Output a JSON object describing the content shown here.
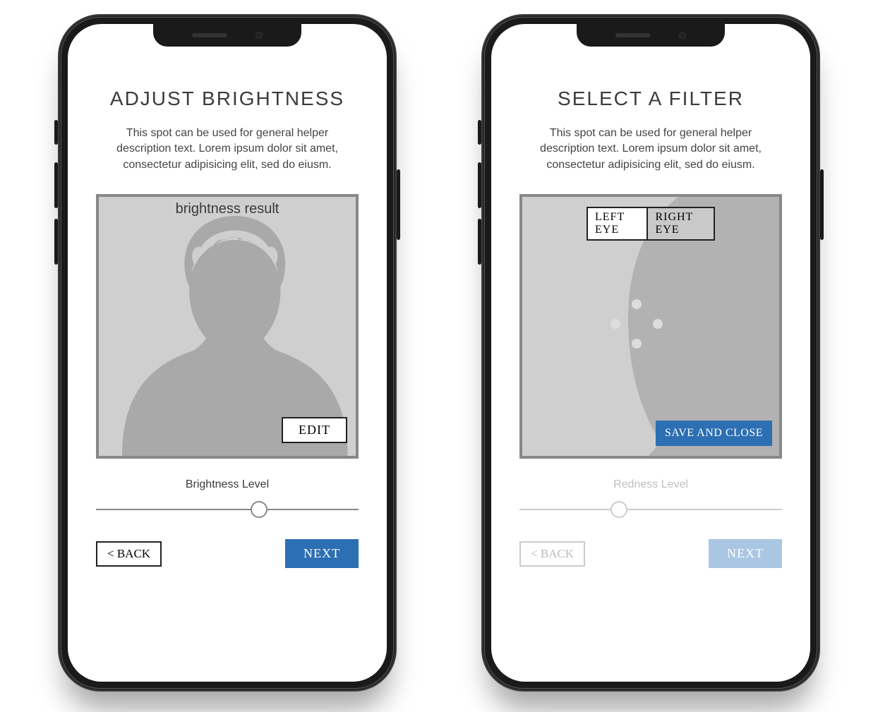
{
  "screens": {
    "brightness": {
      "title": "ADJUST BRIGHTNESS",
      "helper": "This spot can be used for general helper description text. Lorem ipsum dolor sit amet, consectetur adipisicing elit, sed do eiusm.",
      "image_label": "brightness result",
      "edit_label": "EDIT",
      "slider_label": "Brightness Level",
      "slider_pos_percent": 62,
      "back_label": "< BACK",
      "next_label": "NEXT"
    },
    "filter": {
      "title": "SELECT A FILTER",
      "helper": "This spot can be used for general helper description text. Lorem ipsum dolor sit amet, consectetur adipisicing elit, sed do eiusm.",
      "left_eye_label": "LEFT EYE",
      "right_eye_label": "RIGHT EYE",
      "active_eye": "left",
      "save_label": "SAVE AND CLOSE",
      "slider_label": "Redness Level",
      "slider_pos_percent": 38,
      "back_label": "< BACK",
      "next_label": "NEXT",
      "controls_dimmed": true
    }
  }
}
